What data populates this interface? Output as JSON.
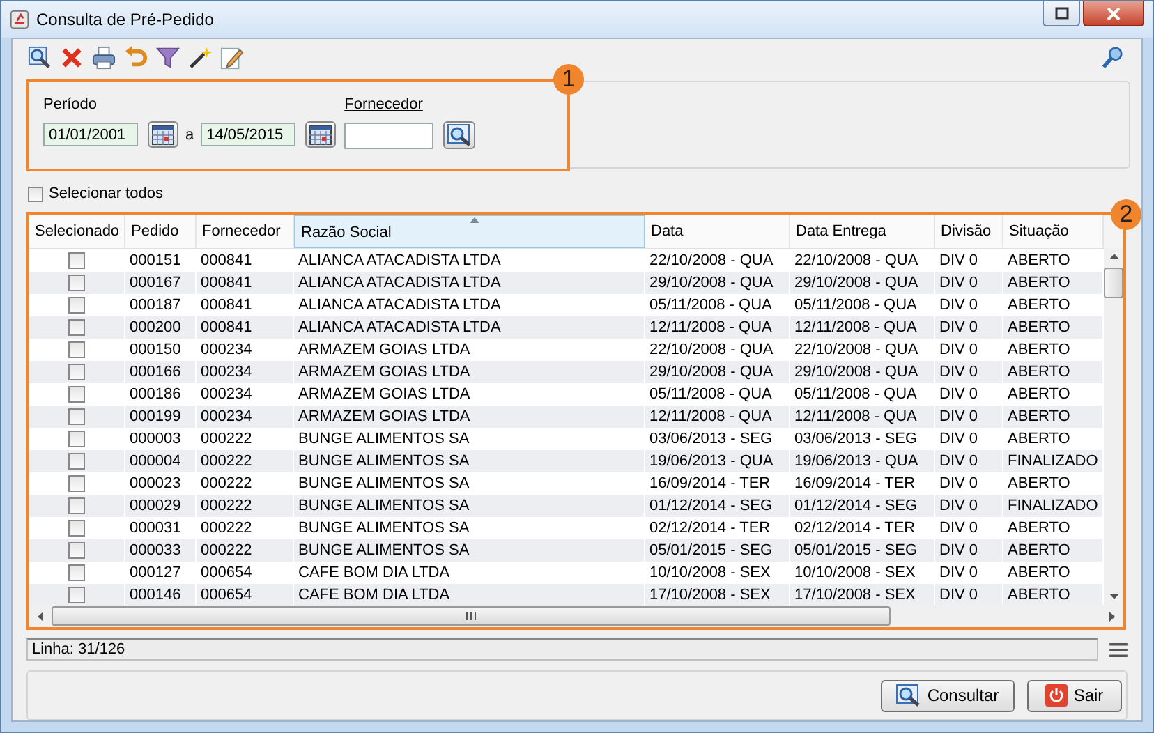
{
  "window": {
    "title": "Consulta de Pré-Pedido"
  },
  "filter": {
    "badge": "1",
    "period_label": "Período",
    "date_from": "01/01/2001",
    "separator": "a",
    "date_to": "14/05/2015",
    "supplier_label": "Fornecedor"
  },
  "select_all": {
    "label": "Selecionar todos",
    "checked": false
  },
  "table": {
    "badge": "2",
    "columns": [
      {
        "label": "Selecionado",
        "sorted": false
      },
      {
        "label": "Pedido",
        "sorted": false
      },
      {
        "label": "Fornecedor",
        "sorted": false
      },
      {
        "label": "Razão Social",
        "sorted": true
      },
      {
        "label": "Data",
        "sorted": false
      },
      {
        "label": "Data Entrega",
        "sorted": false
      },
      {
        "label": "Divisão",
        "sorted": false
      },
      {
        "label": "Situação",
        "sorted": false
      }
    ],
    "rows": [
      {
        "selected": false,
        "cells": [
          "",
          "000151",
          "000841",
          "ALIANCA ATACADISTA LTDA",
          "22/10/2008 - QUA",
          "22/10/2008 - QUA",
          "DIV 0",
          "ABERTO"
        ]
      },
      {
        "selected": false,
        "cells": [
          "",
          "000167",
          "000841",
          "ALIANCA ATACADISTA LTDA",
          "29/10/2008 - QUA",
          "29/10/2008 - QUA",
          "DIV 0",
          "ABERTO"
        ]
      },
      {
        "selected": false,
        "cells": [
          "",
          "000187",
          "000841",
          "ALIANCA ATACADISTA LTDA",
          "05/11/2008 - QUA",
          "05/11/2008 - QUA",
          "DIV 0",
          "ABERTO"
        ]
      },
      {
        "selected": false,
        "cells": [
          "",
          "000200",
          "000841",
          "ALIANCA ATACADISTA LTDA",
          "12/11/2008 - QUA",
          "12/11/2008 - QUA",
          "DIV 0",
          "ABERTO"
        ]
      },
      {
        "selected": false,
        "cells": [
          "",
          "000150",
          "000234",
          "ARMAZEM GOIAS LTDA",
          "22/10/2008 - QUA",
          "22/10/2008 - QUA",
          "DIV 0",
          "ABERTO"
        ]
      },
      {
        "selected": false,
        "cells": [
          "",
          "000166",
          "000234",
          "ARMAZEM GOIAS LTDA",
          "29/10/2008 - QUA",
          "29/10/2008 - QUA",
          "DIV 0",
          "ABERTO"
        ]
      },
      {
        "selected": false,
        "cells": [
          "",
          "000186",
          "000234",
          "ARMAZEM GOIAS LTDA",
          "05/11/2008 - QUA",
          "05/11/2008 - QUA",
          "DIV 0",
          "ABERTO"
        ]
      },
      {
        "selected": false,
        "cells": [
          "",
          "000199",
          "000234",
          "ARMAZEM GOIAS LTDA",
          "12/11/2008 - QUA",
          "12/11/2008 - QUA",
          "DIV 0",
          "ABERTO"
        ]
      },
      {
        "selected": false,
        "cells": [
          "",
          "000003",
          "000222",
          "BUNGE ALIMENTOS SA",
          "03/06/2013 - SEG",
          "03/06/2013 - SEG",
          "DIV 0",
          "ABERTO"
        ]
      },
      {
        "selected": false,
        "cells": [
          "",
          "000004",
          "000222",
          "BUNGE ALIMENTOS SA",
          "19/06/2013 - QUA",
          "19/06/2013 - QUA",
          "DIV 0",
          "FINALIZADO"
        ]
      },
      {
        "selected": false,
        "cells": [
          "",
          "000023",
          "000222",
          "BUNGE ALIMENTOS SA",
          "16/09/2014 - TER",
          "16/09/2014 - TER",
          "DIV 0",
          "ABERTO"
        ]
      },
      {
        "selected": false,
        "cells": [
          "",
          "000029",
          "000222",
          "BUNGE ALIMENTOS SA",
          "01/12/2014 - SEG",
          "01/12/2014 - SEG",
          "DIV 0",
          "FINALIZADO"
        ]
      },
      {
        "selected": false,
        "cells": [
          "",
          "000031",
          "000222",
          "BUNGE ALIMENTOS SA",
          "02/12/2014 - TER",
          "02/12/2014 - TER",
          "DIV 0",
          "ABERTO"
        ]
      },
      {
        "selected": false,
        "cells": [
          "",
          "000033",
          "000222",
          "BUNGE ALIMENTOS SA",
          "05/01/2015 - SEG",
          "05/01/2015 - SEG",
          "DIV 0",
          "ABERTO"
        ]
      },
      {
        "selected": false,
        "cells": [
          "",
          "000127",
          "000654",
          "CAFE BOM DIA LTDA",
          "10/10/2008 - SEX",
          "10/10/2008 - SEX",
          "DIV 0",
          "ABERTO"
        ]
      },
      {
        "selected": false,
        "cells": [
          "",
          "000146",
          "000654",
          "CAFE BOM DIA LTDA",
          "17/10/2008 - SEX",
          "17/10/2008 - SEX",
          "DIV 0",
          "ABERTO"
        ]
      }
    ]
  },
  "status_bar": {
    "text": "Linha: 31/126"
  },
  "buttons": [
    {
      "kind": "search",
      "label": "Consultar"
    },
    {
      "kind": "exit",
      "label": "Sair"
    }
  ]
}
